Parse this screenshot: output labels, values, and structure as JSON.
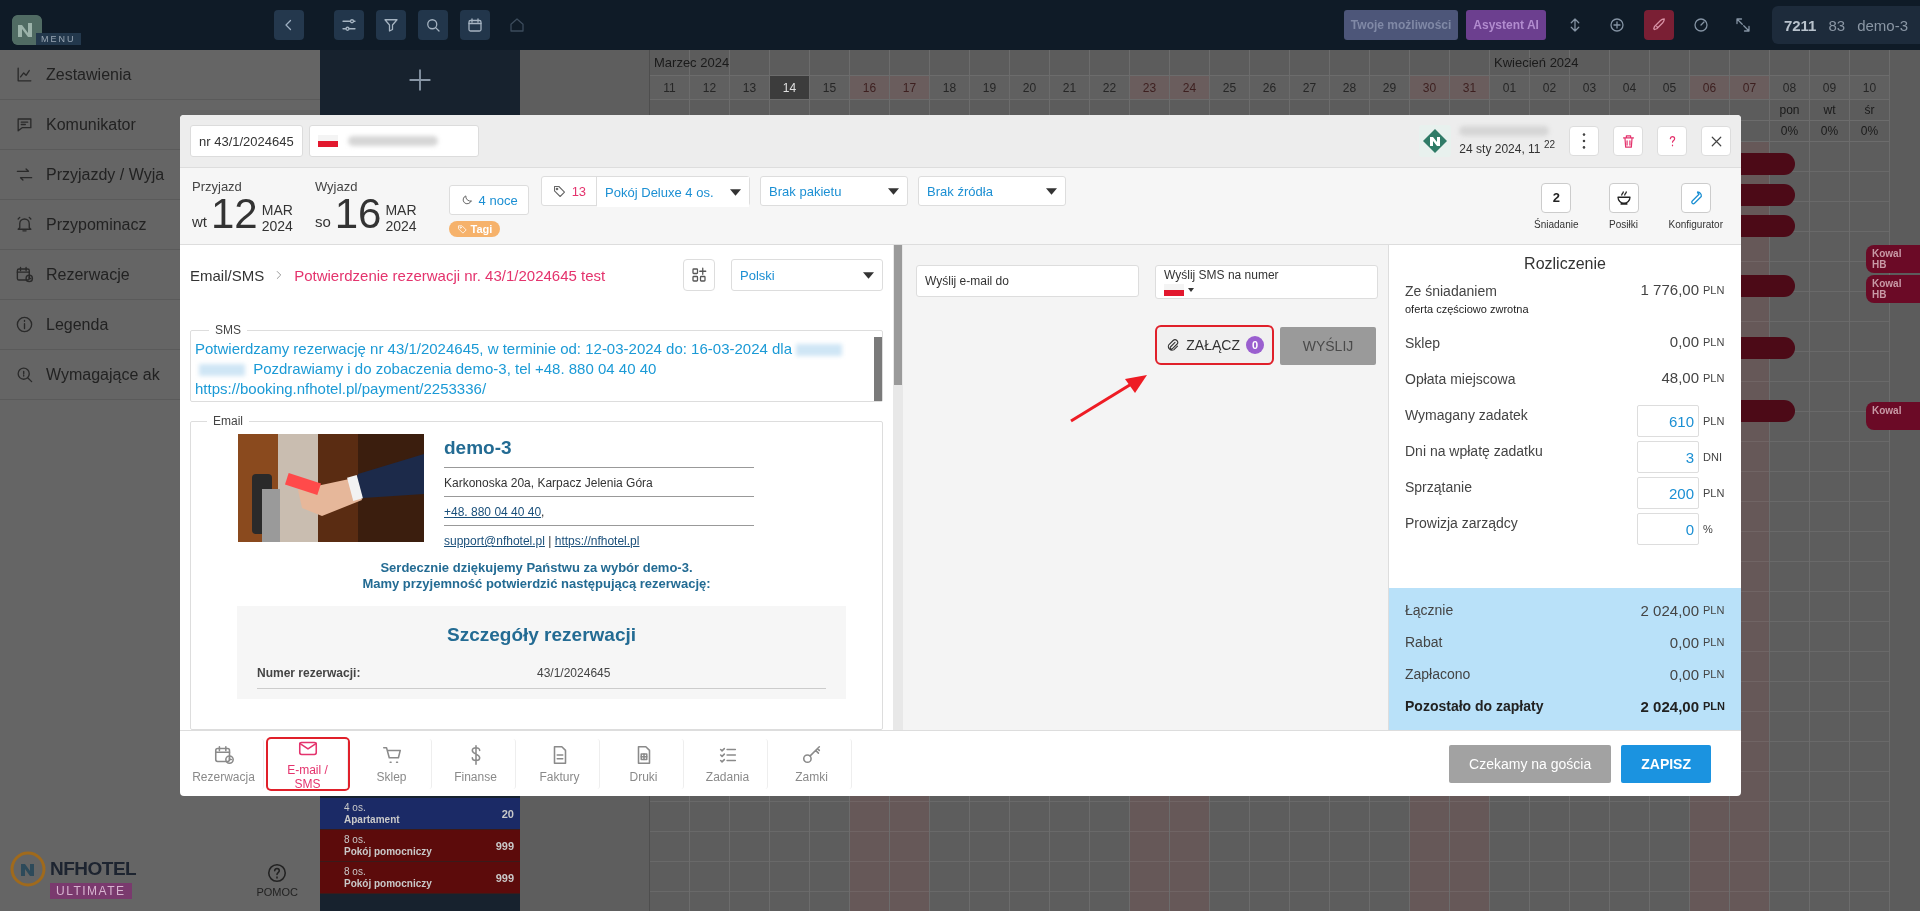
{
  "topbar": {
    "menu_label": "MENU",
    "promo_buttons": [
      {
        "label": "Twoje możliwości",
        "kind": "muted"
      },
      {
        "label": "Asystent AI",
        "kind": "accent"
      }
    ],
    "counter_primary": "7211",
    "counter_secondary": "83",
    "hotel_name": "demo-3"
  },
  "sidebar": {
    "items": [
      {
        "label": "Zestawienia"
      },
      {
        "label": "Komunikator"
      },
      {
        "label": "Przyjazdy / Wyja"
      },
      {
        "label": "Przypominacz"
      },
      {
        "label": "Rezerwacje"
      },
      {
        "label": "Legenda"
      },
      {
        "label": "Wymagające ak"
      }
    ],
    "brand": {
      "name": "NFHOTEL",
      "edition": "ULTIMATE"
    },
    "help_label": "POMOC"
  },
  "calendar": {
    "days": [
      {
        "day": "11",
        "month": "Marzec 2024",
        "weekend": false,
        "today": false
      },
      {
        "day": "12",
        "weekend": false,
        "today": false
      },
      {
        "day": "13",
        "weekend": false,
        "today": false
      },
      {
        "day": "14",
        "weekend": false,
        "today": true
      },
      {
        "day": "15",
        "weekend": false,
        "today": false
      },
      {
        "day": "16",
        "weekend": true,
        "today": false
      },
      {
        "day": "17",
        "weekend": true,
        "today": false
      },
      {
        "day": "18",
        "weekend": false,
        "today": false
      },
      {
        "day": "19",
        "weekend": false,
        "today": false
      },
      {
        "day": "20",
        "weekend": false,
        "today": false
      },
      {
        "day": "21",
        "weekend": false,
        "today": false
      },
      {
        "day": "22",
        "weekend": false,
        "today": false
      },
      {
        "day": "23",
        "weekend": true,
        "today": false
      },
      {
        "day": "24",
        "weekend": true,
        "today": false
      },
      {
        "day": "25",
        "weekend": false,
        "today": false
      },
      {
        "day": "26",
        "weekend": false,
        "today": false
      },
      {
        "day": "27",
        "weekend": false,
        "today": false
      },
      {
        "day": "28",
        "weekend": false,
        "today": false
      },
      {
        "day": "29",
        "weekend": false,
        "today": false
      },
      {
        "day": "30",
        "weekend": true,
        "today": false
      },
      {
        "day": "31",
        "weekend": true,
        "today": false
      },
      {
        "day": "01",
        "month": "Kwiecień 2024",
        "weekend": false,
        "today": false
      },
      {
        "day": "02",
        "weekend": false,
        "today": false
      },
      {
        "day": "03",
        "weekend": false,
        "today": false
      },
      {
        "day": "04",
        "weekend": false,
        "today": false
      },
      {
        "day": "05",
        "weekend": false,
        "today": false
      },
      {
        "day": "06",
        "weekend": true,
        "today": false
      },
      {
        "day": "07",
        "weekend": true,
        "today": false
      },
      {
        "day": "08",
        "weekday": "pon",
        "occupancy": "0%",
        "weekend": false,
        "today": false
      },
      {
        "day": "09",
        "weekday": "wt",
        "occupancy": "0%",
        "weekend": false,
        "today": false
      },
      {
        "day": "10",
        "weekday": "śr",
        "occupancy": "0%",
        "weekend": false,
        "today": false
      }
    ],
    "booking_chips": [
      {
        "name": "Kowal",
        "board": "HB"
      },
      {
        "name": "Kowal",
        "board": "HB"
      },
      {
        "name": "Kowal"
      }
    ],
    "room_rows": [
      {
        "guests": "4 os.",
        "type": "Apartament",
        "number": "20",
        "kind": "apartment"
      },
      {
        "guests": "8 os.",
        "type": "Pokój pomocniczy",
        "number": "999",
        "kind": "auxiliary"
      },
      {
        "guests": "8 os.",
        "type": "Pokój pomocniczy",
        "number": "999",
        "kind": "auxiliary"
      }
    ]
  },
  "modal": {
    "reservation_number": "nr 43/1/2024645",
    "created": "24 sty 2024, 11 $^{22}$",
    "stay": [
      {
        "label": "Przyjazd",
        "weekday": "wt",
        "day": "12",
        "month": "MAR",
        "year": "2024"
      },
      {
        "label": "Wyjazd",
        "weekday": "so",
        "day": "16",
        "month": "MAR",
        "year": "2024"
      }
    ],
    "nights": "4 noce",
    "tags_label": "Tagi",
    "room_number": "13",
    "room": "Pokój Deluxe 4 os.",
    "package": "Brak pakietu",
    "source": "Brak źródła",
    "extras": [
      {
        "kind": "count",
        "value": "2",
        "label": "Śniadanie"
      },
      {
        "kind": "meals",
        "label": "Posiłki"
      },
      {
        "kind": "config",
        "label": "Konfigurator"
      }
    ],
    "composer": {
      "breadcrumb_root": "Email/SMS",
      "template": "Potwierdzenie rezerwacji nr. 43/1/2024645 test",
      "language": "Polski",
      "sms_legend": "SMS",
      "sms_before": "Potwierdzamy rezerwację nr 43/1/2024645, w terminie od: 12-03-2024 do: 16-03-2024 dla",
      "sms_after": "Pozdrawiamy i do zobaczenia demo-3, tel +48. 880 04 40 40 https://booking.nfhotel.pl/payment/2253336/",
      "email_legend": "Email",
      "email": {
        "hotel": "demo-3",
        "address": "Karkonoska 20a, Karpacz Jelenia Góra",
        "phone": "+48. 880 04 40 40",
        "phone_suffix": ",",
        "email": "support@nfhotel.pl",
        "separator": "|",
        "website": "https://nfhotel.pl",
        "thanks": [
          "Serdecznie dziękujemy Państwu za wybór demo-3.",
          "Mamy przyjemność potwierdzić następującą rezerwację:"
        ],
        "details_title": "Szczegóły rezerwacji",
        "details": [
          {
            "label": "Numer rezerwacji:",
            "value": "43/1/2024645"
          }
        ]
      }
    },
    "send": {
      "email_placeholder": "Wyślij e-mail do",
      "sms_label": "Wyślij SMS na numer",
      "attach_label": "ZAŁĄCZ",
      "attach_count": "0",
      "attach_highlighted": true,
      "send_label": "WYŚLIJ",
      "send_disabled": true
    },
    "settlement": {
      "title": "Rozliczenie",
      "lines": [
        {
          "kind": "amount",
          "label": "Ze śniadaniem",
          "note": "oferta częściowo zwrotna",
          "value": "1 776,00",
          "unit": "PLN"
        },
        {
          "kind": "amount",
          "label": "Sklep",
          "value": "0,00",
          "unit": "PLN"
        },
        {
          "kind": "amount",
          "label": "Opłata miejscowa",
          "value": "48,00",
          "unit": "PLN"
        },
        {
          "kind": "input",
          "label": "Wymagany zadatek",
          "value": "610",
          "unit": "PLN"
        },
        {
          "kind": "input",
          "label": "Dni na wpłatę zadatku",
          "value": "3",
          "unit": "DNI"
        },
        {
          "kind": "input",
          "label": "Sprzątanie",
          "value": "200",
          "unit": "PLN"
        },
        {
          "kind": "input",
          "label": "Prowizja zarządcy",
          "value": "0",
          "unit": "%"
        }
      ],
      "totals": [
        {
          "label": "Łącznie",
          "value": "2 024,00",
          "unit": "PLN",
          "emphasis": false
        },
        {
          "label": "Rabat",
          "value": "0,00",
          "unit": "PLN",
          "emphasis": false
        },
        {
          "label": "Zapłacono",
          "value": "0,00",
          "unit": "PLN",
          "emphasis": false
        },
        {
          "label": "Pozostało do zapłaty",
          "value": "2 024,00",
          "unit": "PLN",
          "emphasis": true
        }
      ]
    },
    "footer_tabs": [
      {
        "label": "Rezerwacja",
        "selected": false,
        "highlighted": false
      },
      {
        "label": "E-mail / SMS",
        "selected": true,
        "highlighted": true
      },
      {
        "label": "Sklep",
        "selected": false,
        "highlighted": false
      },
      {
        "label": "Finanse",
        "selected": false,
        "highlighted": false
      },
      {
        "label": "Faktury",
        "selected": false,
        "highlighted": false
      },
      {
        "label": "Druki",
        "selected": false,
        "highlighted": false
      },
      {
        "label": "Zadania",
        "selected": false,
        "highlighted": false
      },
      {
        "label": "Zamki",
        "selected": false,
        "highlighted": false
      }
    ],
    "footer_buttons": [
      {
        "label": "Czekamy na gościa",
        "kind": "secondary"
      },
      {
        "label": "ZAPISZ",
        "kind": "primary"
      }
    ]
  }
}
